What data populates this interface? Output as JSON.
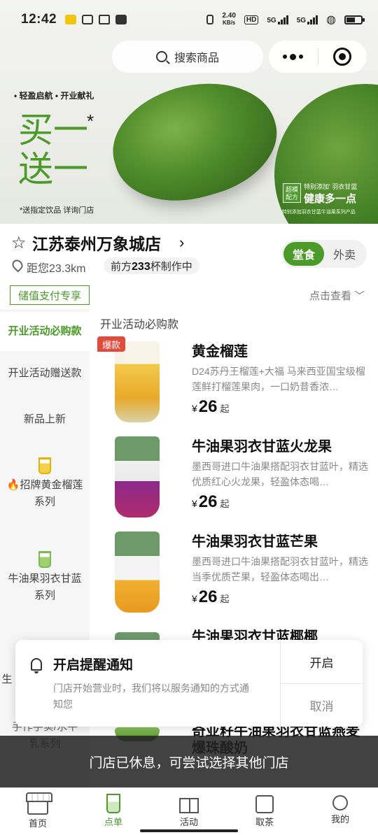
{
  "status_bar": {
    "time": "12:42",
    "net_speed": "2.40",
    "net_unit": "KB/s",
    "sim1": "5G",
    "sim2": "5G",
    "hd": "HD"
  },
  "header": {
    "search_placeholder": "搜索商品"
  },
  "banner": {
    "tagline": "• 轻盈启航 • 开业献礼",
    "headline_line1": "买一",
    "headline_line2": "送一",
    "headline_star": "*",
    "note": "*送指定饮品 详询门店",
    "side_logo": "超模配方",
    "side_small": "特别添加' 羽衣甘蓝",
    "side_big": "健康多一点",
    "side_tiny": "*特别添加羽衣甘蓝牛油果系列产品"
  },
  "store": {
    "name": "江苏泰州万象城店",
    "distance": "距您23.3km",
    "queue_prefix": "前方",
    "queue_count": "233",
    "queue_suffix": "杯制作中",
    "mode_dine_in": "堂食",
    "mode_takeout": "外卖"
  },
  "stored_pay_label": "储值支付专享",
  "view_more_label": "点击查看 ﹀",
  "sidebar": {
    "items": [
      {
        "label": "开业活动必购款"
      },
      {
        "label": "开业活动赠送款"
      },
      {
        "label": "新品上新"
      },
      {
        "label": "🔥招牌黄金榴莲系列"
      },
      {
        "label": "牛油果羽衣甘蓝系列"
      },
      {
        "label": "生"
      },
      {
        "label": "手作手实/水牛乳系列"
      }
    ]
  },
  "category_title": "开业活动必购款",
  "products": [
    {
      "badge": "爆款",
      "name": "黄金榴莲",
      "desc": "D24苏丹王榴莲+大福 马来西亚国宝级榴莲鲜打榴莲果肉，一口奶昔香浓…",
      "currency": "¥",
      "price": "26",
      "price_suffix": "起"
    },
    {
      "name": "牛油果羽衣甘蓝火龙果",
      "desc": "墨西哥进口牛油果搭配羽衣甘蓝叶，精选优质红心火龙果，轻盈体态喝…",
      "currency": "¥",
      "price": "26",
      "price_suffix": "起"
    },
    {
      "name": "牛油果羽衣甘蓝芒果",
      "desc": "墨西哥进口牛油果搭配羽衣甘蓝叶，精选当季优质芒果，轻盈体态喝出…",
      "currency": "¥",
      "price": "26",
      "price_suffix": "起"
    },
    {
      "name": "牛油果羽衣甘蓝椰椰"
    },
    {
      "name": "奇亚籽牛油果羽衣甘蓝燕麦爆珠酸奶"
    }
  ],
  "notification": {
    "title": "开启提醒通知",
    "body": "门店开始营业时，我们将以服务通知的方式通知您",
    "open": "开启",
    "cancel": "取消"
  },
  "closed_toast": "门店已休息，可尝试选择其他门店",
  "tabbar": {
    "items": [
      {
        "label": "首页"
      },
      {
        "label": "点单"
      },
      {
        "label": "活动"
      },
      {
        "label": "取茶"
      },
      {
        "label": "我的"
      }
    ]
  },
  "colors": {
    "brand_green": "#4b9a2a",
    "hot_red": "#e24b3b"
  }
}
